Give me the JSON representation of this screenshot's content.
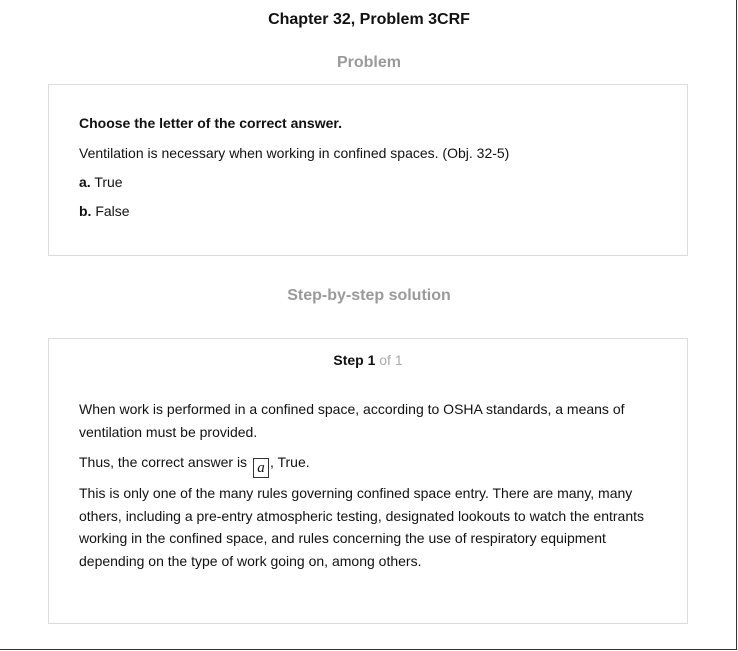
{
  "page": {
    "title": "Chapter 32, Problem 3CRF"
  },
  "problem": {
    "heading": "Problem",
    "instruction": "Choose the letter of the correct answer.",
    "question": "Ventilation is necessary when working in confined spaces. (Obj. 32-5)",
    "options": [
      {
        "letter": "a.",
        "text": "True"
      },
      {
        "letter": "b.",
        "text": "False"
      }
    ]
  },
  "solution": {
    "heading": "Step-by-step solution",
    "step_word": "Step 1",
    "step_of": "of 1",
    "paragraph1": "When work is performed in a confined space, according to OSHA standards, a means of ventilation must be provided.",
    "answer_prefix": "Thus, the correct answer is",
    "answer_letter": "a",
    "answer_suffix": ", True.",
    "paragraph3": "This is only one of the many rules governing confined space entry. There are many, many others, including a pre-entry atmospheric testing, designated lookouts to watch the entrants working in the confined space, and rules concerning the use of respiratory equipment depending on the type of work going on, among others."
  }
}
